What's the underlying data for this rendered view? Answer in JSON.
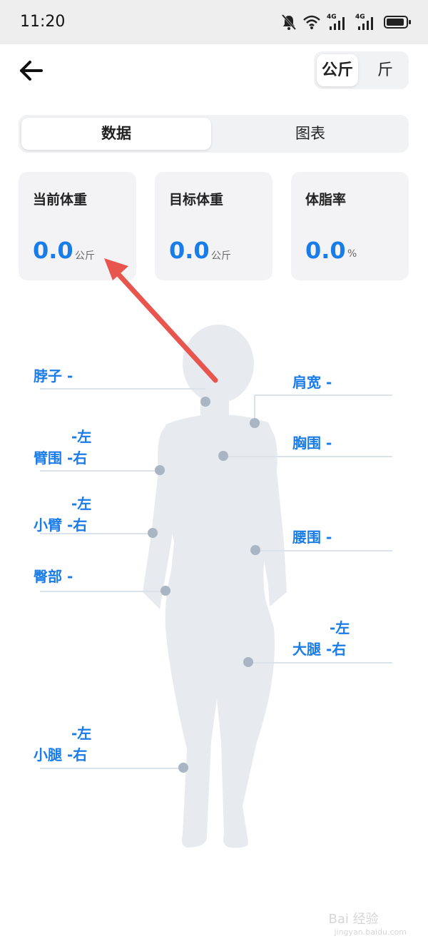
{
  "status_bar": {
    "time": "11:20",
    "signal_1_label": "4G",
    "signal_2_label": "4G",
    "icons": [
      "mute-icon",
      "wifi-icon",
      "signal-icon",
      "signal-icon",
      "battery-icon"
    ]
  },
  "header": {
    "back_icon": "arrow-left-icon",
    "unit_options": [
      "公斤",
      "斤"
    ],
    "selected_unit": "公斤"
  },
  "tabs": {
    "items": [
      "数据",
      "图表"
    ],
    "selected": "数据"
  },
  "cards": [
    {
      "title": "当前体重",
      "value": "0.0",
      "unit": "公斤"
    },
    {
      "title": "目标体重",
      "value": "0.0",
      "unit": "公斤"
    },
    {
      "title": "体脂率",
      "value": "0.0",
      "unit": "%"
    }
  ],
  "measurements": {
    "neck": "脖子 -",
    "shoulder": "肩宽 -",
    "arm_left": "-左",
    "arm_right": "臂围 -右",
    "chest": "胸围 -",
    "forearm_left": "-左",
    "forearm_right": "小臂 -右",
    "waist": "腰围 -",
    "hip": "臀部 -",
    "thigh_left": "-左",
    "thigh_right": "大腿 -右",
    "calf_left": "-左",
    "calf_right": "小腿 -右"
  },
  "watermark": {
    "text": "Bai 经验",
    "sub": "jingyan.baidu.com"
  },
  "colors": {
    "accent": "#1a7ce8",
    "annotation_arrow": "#e8544e",
    "silhouette": "#e7ebf0"
  }
}
